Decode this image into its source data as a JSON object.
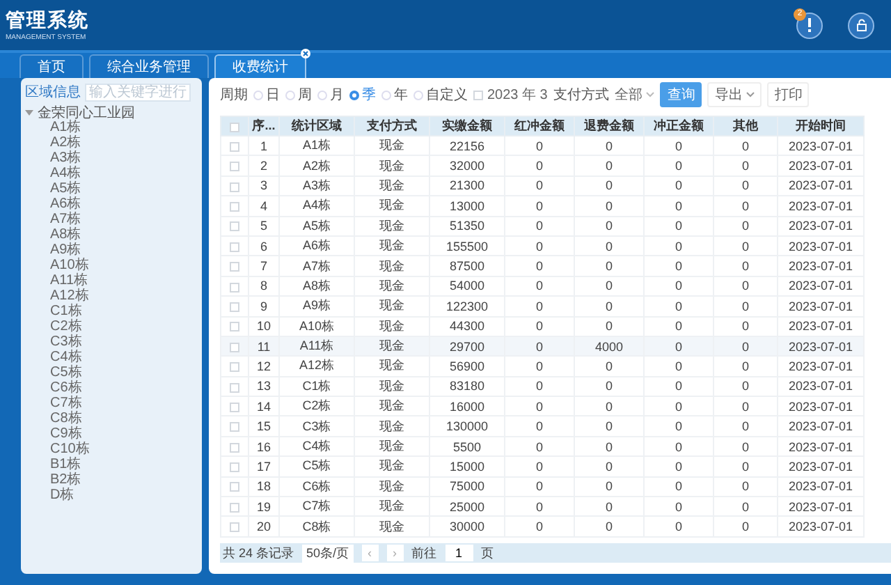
{
  "header": {
    "title": "管理系统",
    "subtitle": "MANAGEMENT SYSTEM",
    "alert_badge": "2"
  },
  "tabs": [
    {
      "label": "首页",
      "selected": false,
      "closable": false
    },
    {
      "label": "综合业务管理",
      "selected": false,
      "closable": false
    },
    {
      "label": "收费统计",
      "selected": true,
      "closable": true
    }
  ],
  "sidebar": {
    "title": "区域信息",
    "search_placeholder": "输入关键字进行",
    "tree": [
      {
        "label": "金荣同心工业园",
        "expanded": true,
        "children": [
          {
            "label": "A1栋"
          },
          {
            "label": "A2栋"
          },
          {
            "label": "A3栋"
          },
          {
            "label": "A4栋"
          },
          {
            "label": "A5栋"
          },
          {
            "label": "A6栋"
          },
          {
            "label": "A7栋"
          },
          {
            "label": "A8栋"
          },
          {
            "label": "A9栋"
          },
          {
            "label": "A10栋"
          },
          {
            "label": "A11栋"
          },
          {
            "label": "A12栋"
          },
          {
            "label": "C1栋"
          },
          {
            "label": "C2栋"
          },
          {
            "label": "C3栋"
          },
          {
            "label": "C4栋"
          },
          {
            "label": "C5栋"
          },
          {
            "label": "C6栋"
          },
          {
            "label": "C7栋"
          },
          {
            "label": "C8栋"
          },
          {
            "label": "C9栋"
          },
          {
            "label": "C10栋"
          },
          {
            "label": "B1栋"
          },
          {
            "label": "B2栋"
          },
          {
            "label": "D栋"
          }
        ]
      }
    ]
  },
  "filters": {
    "period_label": "周期",
    "periods": [
      {
        "label": "日",
        "selected": false
      },
      {
        "label": "周",
        "selected": false
      },
      {
        "label": "月",
        "selected": false
      },
      {
        "label": "季",
        "selected": true
      },
      {
        "label": "年",
        "selected": false
      },
      {
        "label": "自定义",
        "selected": false
      }
    ],
    "date_value": "2023 年 3",
    "payment_label": "支付方式",
    "payment_value": "全部",
    "query_button": "查询",
    "export_button": "导出",
    "print_button": "打印"
  },
  "table": {
    "all_checked": false,
    "columns": [
      "序...",
      "统计区域",
      "支付方式",
      "实缴金额",
      "红冲金额",
      "退费金额",
      "冲正金额",
      "其他",
      "开始时间"
    ],
    "rows": [
      {
        "checked": false,
        "highlighted": false,
        "cells": [
          "1",
          "A1栋",
          "现金",
          "22156",
          "0",
          "0",
          "0",
          "0",
          "2023-07-01"
        ]
      },
      {
        "checked": false,
        "highlighted": false,
        "cells": [
          "2",
          "A2栋",
          "现金",
          "32000",
          "0",
          "0",
          "0",
          "0",
          "2023-07-01"
        ]
      },
      {
        "checked": false,
        "highlighted": false,
        "cells": [
          "3",
          "A3栋",
          "现金",
          "21300",
          "0",
          "0",
          "0",
          "0",
          "2023-07-01"
        ]
      },
      {
        "checked": false,
        "highlighted": false,
        "cells": [
          "4",
          "A4栋",
          "现金",
          "13000",
          "0",
          "0",
          "0",
          "0",
          "2023-07-01"
        ]
      },
      {
        "checked": false,
        "highlighted": false,
        "cells": [
          "5",
          "A5栋",
          "现金",
          "51350",
          "0",
          "0",
          "0",
          "0",
          "2023-07-01"
        ]
      },
      {
        "checked": false,
        "highlighted": false,
        "cells": [
          "6",
          "A6栋",
          "现金",
          "155500",
          "0",
          "0",
          "0",
          "0",
          "2023-07-01"
        ]
      },
      {
        "checked": false,
        "highlighted": false,
        "cells": [
          "7",
          "A7栋",
          "现金",
          "87500",
          "0",
          "0",
          "0",
          "0",
          "2023-07-01"
        ]
      },
      {
        "checked": false,
        "highlighted": false,
        "cells": [
          "8",
          "A8栋",
          "现金",
          "54000",
          "0",
          "0",
          "0",
          "0",
          "2023-07-01"
        ]
      },
      {
        "checked": false,
        "highlighted": false,
        "cells": [
          "9",
          "A9栋",
          "现金",
          "122300",
          "0",
          "0",
          "0",
          "0",
          "2023-07-01"
        ]
      },
      {
        "checked": false,
        "highlighted": false,
        "cells": [
          "10",
          "A10栋",
          "现金",
          "44300",
          "0",
          "0",
          "0",
          "0",
          "2023-07-01"
        ]
      },
      {
        "checked": false,
        "highlighted": true,
        "cells": [
          "11",
          "A11栋",
          "现金",
          "29700",
          "0",
          "4000",
          "0",
          "0",
          "2023-07-01"
        ]
      },
      {
        "checked": false,
        "highlighted": false,
        "cells": [
          "12",
          "A12栋",
          "现金",
          "56900",
          "0",
          "0",
          "0",
          "0",
          "2023-07-01"
        ]
      },
      {
        "checked": false,
        "highlighted": false,
        "cells": [
          "13",
          "C1栋",
          "现金",
          "83180",
          "0",
          "0",
          "0",
          "0",
          "2023-07-01"
        ]
      },
      {
        "checked": false,
        "highlighted": false,
        "cells": [
          "14",
          "C2栋",
          "现金",
          "16000",
          "0",
          "0",
          "0",
          "0",
          "2023-07-01"
        ]
      },
      {
        "checked": false,
        "highlighted": false,
        "cells": [
          "15",
          "C3栋",
          "现金",
          "130000",
          "0",
          "0",
          "0",
          "0",
          "2023-07-01"
        ]
      },
      {
        "checked": false,
        "highlighted": false,
        "cells": [
          "16",
          "C4栋",
          "现金",
          "5500",
          "0",
          "0",
          "0",
          "0",
          "2023-07-01"
        ]
      },
      {
        "checked": false,
        "highlighted": false,
        "cells": [
          "17",
          "C5栋",
          "现金",
          "15000",
          "0",
          "0",
          "0",
          "0",
          "2023-07-01"
        ]
      },
      {
        "checked": false,
        "highlighted": false,
        "cells": [
          "18",
          "C6栋",
          "现金",
          "75000",
          "0",
          "0",
          "0",
          "0",
          "2023-07-01"
        ]
      },
      {
        "checked": false,
        "highlighted": false,
        "cells": [
          "19",
          "C7栋",
          "现金",
          "25000",
          "0",
          "0",
          "0",
          "0",
          "2023-07-01"
        ]
      },
      {
        "checked": false,
        "highlighted": false,
        "cells": [
          "20",
          "C8栋",
          "现金",
          "30000",
          "0",
          "0",
          "0",
          "0",
          "2023-07-01"
        ]
      }
    ]
  },
  "pagination": {
    "total": "共 24 条记录",
    "page_size": "50条/页",
    "prev": "‹",
    "next": "›",
    "goto_label": "前往",
    "page": "1",
    "page_suffix": "页"
  }
}
